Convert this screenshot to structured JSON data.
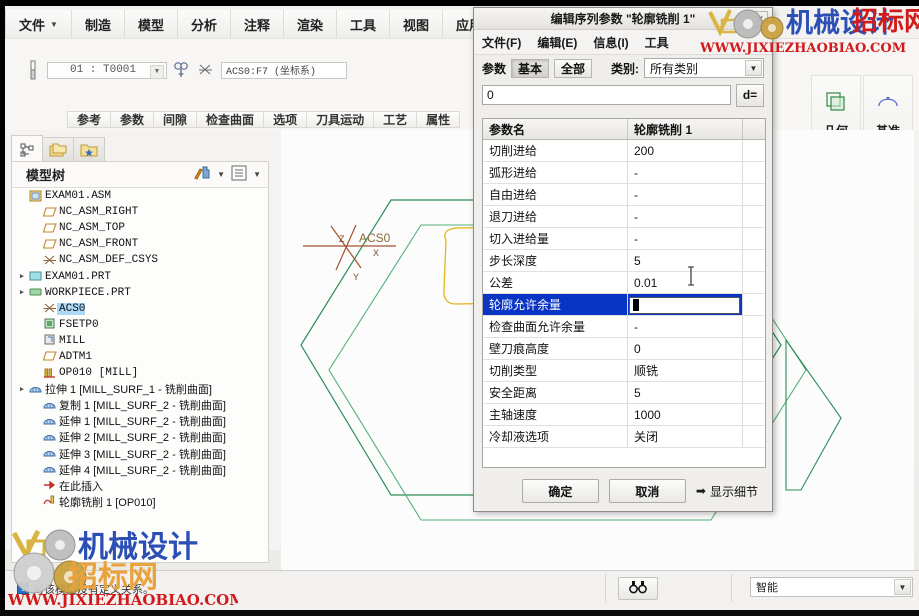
{
  "app": {
    "menu": [
      {
        "label": "文件",
        "has_caret": true
      },
      {
        "label": "制造",
        "has_caret": false
      },
      {
        "label": "模型",
        "has_caret": false
      },
      {
        "label": "分析",
        "has_caret": false
      },
      {
        "label": "注释",
        "has_caret": false
      },
      {
        "label": "渲染",
        "has_caret": false
      },
      {
        "label": "工具",
        "has_caret": false
      },
      {
        "label": "视图",
        "has_caret": false
      },
      {
        "label": "应用程序",
        "has_caret": false
      }
    ]
  },
  "ribbon": {
    "tool_combo_value": "01 : T0001",
    "csys_field_value": "ACS0:F7 (坐标系)",
    "tabs": [
      {
        "label": "参考"
      },
      {
        "label": "参数"
      },
      {
        "label": "间隙"
      },
      {
        "label": "检查曲面"
      },
      {
        "label": "选项"
      },
      {
        "label": "刀具运动"
      },
      {
        "label": "工艺"
      },
      {
        "label": "属性"
      }
    ],
    "groups": [
      {
        "label": "几何",
        "caret": "▼"
      },
      {
        "label": "基准",
        "caret": "▼"
      }
    ]
  },
  "left_dock": {
    "tabs": [
      {
        "name": "model-tree-tab"
      },
      {
        "name": "folder-browser-tab"
      },
      {
        "name": "favorites-tab"
      }
    ],
    "title": "模型树",
    "tree": [
      {
        "indent": 0,
        "expander": "",
        "icon": "assembly-icon",
        "label": "EXAM01.ASM",
        "selected": false,
        "cn": false
      },
      {
        "indent": 1,
        "expander": "",
        "icon": "datum-plane-icon",
        "label": "NC_ASM_RIGHT",
        "selected": false,
        "cn": false
      },
      {
        "indent": 1,
        "expander": "",
        "icon": "datum-plane-icon",
        "label": "NC_ASM_TOP",
        "selected": false,
        "cn": false
      },
      {
        "indent": 1,
        "expander": "",
        "icon": "datum-plane-icon",
        "label": "NC_ASM_FRONT",
        "selected": false,
        "cn": false
      },
      {
        "indent": 1,
        "expander": "",
        "icon": "csys-icon",
        "label": "NC_ASM_DEF_CSYS",
        "selected": false,
        "cn": false
      },
      {
        "indent": 0,
        "expander": "▶",
        "icon": "part-icon",
        "label": "EXAM01.PRT",
        "selected": false,
        "cn": false
      },
      {
        "indent": 0,
        "expander": "▶",
        "icon": "workpiece-icon",
        "label": "WORKPIECE.PRT",
        "selected": false,
        "cn": false
      },
      {
        "indent": 1,
        "expander": "",
        "icon": "csys-icon",
        "label": "ACS0",
        "selected": true,
        "cn": false
      },
      {
        "indent": 1,
        "expander": "",
        "icon": "machine-icon",
        "label": "FSETP0",
        "selected": false,
        "cn": false
      },
      {
        "indent": 1,
        "expander": "",
        "icon": "mill-icon",
        "label": "MILL",
        "selected": false,
        "cn": false
      },
      {
        "indent": 1,
        "expander": "",
        "icon": "datum-plane-icon",
        "label": "ADTM1",
        "selected": false,
        "cn": false
      },
      {
        "indent": 1,
        "expander": "",
        "icon": "operation-icon",
        "label": "OP010 [MILL]",
        "selected": false,
        "cn": false
      },
      {
        "indent": 0,
        "expander": "▶",
        "icon": "surface-icon",
        "label": "拉伸 1 [MILL_SURF_1 - 铣削曲面]",
        "selected": false,
        "cn": true
      },
      {
        "indent": 1,
        "expander": "",
        "icon": "surface-icon",
        "label": "复制 1 [MILL_SURF_2 - 铣削曲面]",
        "selected": false,
        "cn": true
      },
      {
        "indent": 1,
        "expander": "",
        "icon": "surface-icon",
        "label": "延伸 1 [MILL_SURF_2 - 铣削曲面]",
        "selected": false,
        "cn": true
      },
      {
        "indent": 1,
        "expander": "",
        "icon": "surface-icon",
        "label": "延伸 2 [MILL_SURF_2 - 铣削曲面]",
        "selected": false,
        "cn": true
      },
      {
        "indent": 1,
        "expander": "",
        "icon": "surface-icon",
        "label": "延伸 3 [MILL_SURF_2 - 铣削曲面]",
        "selected": false,
        "cn": true
      },
      {
        "indent": 1,
        "expander": "",
        "icon": "surface-icon",
        "label": "延伸 4 [MILL_SURF_2 - 铣削曲面]",
        "selected": false,
        "cn": true
      },
      {
        "indent": 1,
        "expander": "",
        "icon": "insert-here-icon",
        "label": "在此插入",
        "selected": false,
        "cn": true
      },
      {
        "indent": 1,
        "expander": "",
        "icon": "profile-mill-icon",
        "label": "轮廓铣削 1 [OP010]",
        "selected": false,
        "cn": true
      }
    ]
  },
  "graphics": {
    "csys_label": "ACS0",
    "axis_x": "X",
    "axis_y": "Y",
    "axis_z": "Z"
  },
  "dialog": {
    "title": "编辑序列参数 \"轮廓铣削 1\"",
    "close_label": "✕",
    "menus": [
      {
        "label": "文件(F)"
      },
      {
        "label": "编辑(E)"
      },
      {
        "label": "信息(I)"
      },
      {
        "label": "工具"
      }
    ],
    "param_label": "参数",
    "seg_basic": "基本",
    "seg_all": "全部",
    "category_label": "类别:",
    "category_value": "所有类别",
    "edit_value": "0",
    "d_button": "d=",
    "columns": [
      "参数名",
      "轮廓铣削 1",
      ""
    ],
    "rows": [
      {
        "name": "切削进给",
        "value": "200",
        "selected": false
      },
      {
        "name": "弧形进给",
        "value": "-",
        "selected": false
      },
      {
        "name": "自由进给",
        "value": "-",
        "selected": false
      },
      {
        "name": "退刀进给",
        "value": "-",
        "selected": false
      },
      {
        "name": "切入进给量",
        "value": "-",
        "selected": false
      },
      {
        "name": "步长深度",
        "value": "5",
        "selected": false
      },
      {
        "name": "公差",
        "value": "0.01",
        "selected": false
      },
      {
        "name": "轮廓允许余量",
        "value": "0",
        "selected": true
      },
      {
        "name": "检查曲面允许余量",
        "value": "-",
        "selected": false
      },
      {
        "name": "壁刀痕高度",
        "value": "0",
        "selected": false
      },
      {
        "name": "切削类型",
        "value": "顺铣",
        "selected": false
      },
      {
        "name": "安全距离",
        "value": "5",
        "selected": false
      },
      {
        "name": "主轴速度",
        "value": "1000",
        "selected": false
      },
      {
        "name": "冷却液选项",
        "value": "关闭",
        "selected": false
      }
    ],
    "ok_label": "确定",
    "cancel_label": "取消",
    "details_label": "显示细节",
    "details_arrow": "➡"
  },
  "status": {
    "message": "对该模型没有定义关系。",
    "smart_select_value": "智能",
    "smart_select_arrow": "▼"
  },
  "watermark": {
    "brand_cn": "机械设计",
    "brand_cn2": "招标网",
    "url": "WWW.JIXIEZHAOBIAO.COM",
    "color_blue": "#2b4fb5",
    "color_orange": "#e8a33d",
    "color_red": "#d11a1a"
  }
}
